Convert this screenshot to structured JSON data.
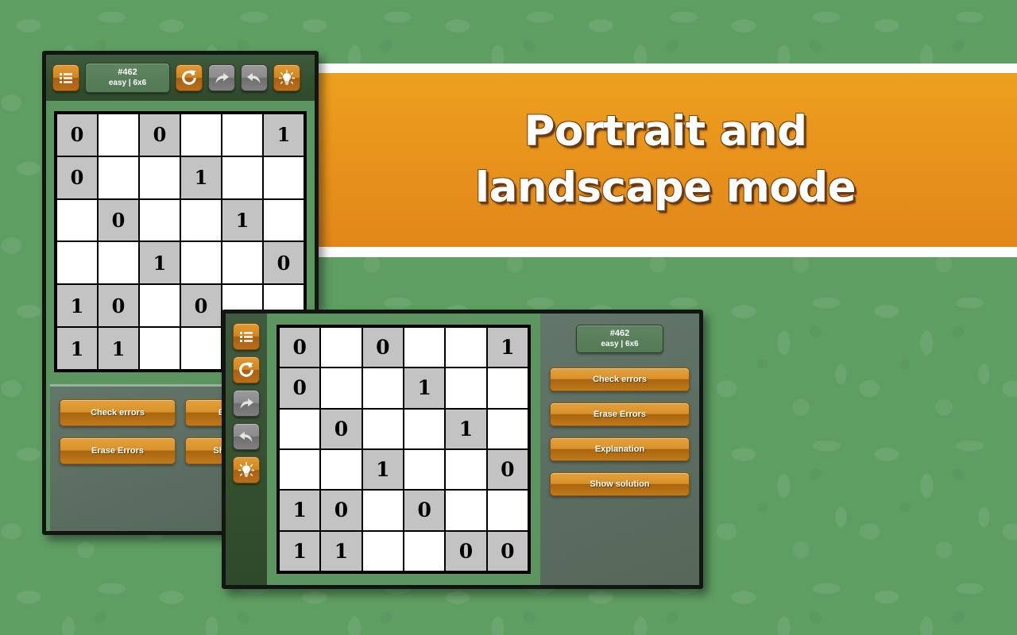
{
  "banner": {
    "line1": "Portrait and",
    "line2": "landscape mode",
    "bg_color": "#e8941c",
    "text_color": "#ffffff"
  },
  "theme": {
    "background_color": "#5f9e63",
    "panel_color": "#5b6d61",
    "button_color": "#d9912a",
    "given_cell_color": "#c3c3c3",
    "empty_cell_color": "#ffffff"
  },
  "puzzle": {
    "id": "#462",
    "subtitle": "easy | 6x6",
    "size": "6x6",
    "difficulty": "easy",
    "rows": [
      [
        "0",
        "",
        "0",
        "",
        "",
        "1"
      ],
      [
        "0",
        "",
        "",
        "1",
        "",
        ""
      ],
      [
        "",
        "0",
        "",
        "",
        "1",
        ""
      ],
      [
        "",
        "",
        "1",
        "",
        "",
        "0"
      ],
      [
        "1",
        "0",
        "",
        "0",
        "",
        ""
      ],
      [
        "1",
        "1",
        "",
        "",
        "0",
        "0"
      ]
    ]
  },
  "portrait": {
    "toolbar": [
      {
        "name": "menu-icon",
        "icon": "list",
        "style": "orange"
      },
      {
        "name": "restart-icon",
        "icon": "refresh",
        "style": "orange"
      },
      {
        "name": "redo-icon",
        "icon": "redo",
        "style": "gray"
      },
      {
        "name": "undo-icon",
        "icon": "undo",
        "style": "gray"
      },
      {
        "name": "hint-icon",
        "icon": "lightbulb",
        "style": "orange"
      }
    ],
    "buttons": [
      "Check errors",
      "Explanation",
      "Erase Errors",
      "Show solution"
    ]
  },
  "landscape": {
    "toolbar": [
      {
        "name": "menu-icon",
        "icon": "list",
        "style": "orange"
      },
      {
        "name": "restart-icon",
        "icon": "refresh",
        "style": "orange"
      },
      {
        "name": "redo-icon",
        "icon": "redo",
        "style": "gray"
      },
      {
        "name": "undo-icon",
        "icon": "undo",
        "style": "gray"
      },
      {
        "name": "hint-icon",
        "icon": "lightbulb",
        "style": "orange"
      }
    ],
    "buttons": [
      "Check errors",
      "Erase Errors",
      "Explanation",
      "Show solution"
    ]
  }
}
